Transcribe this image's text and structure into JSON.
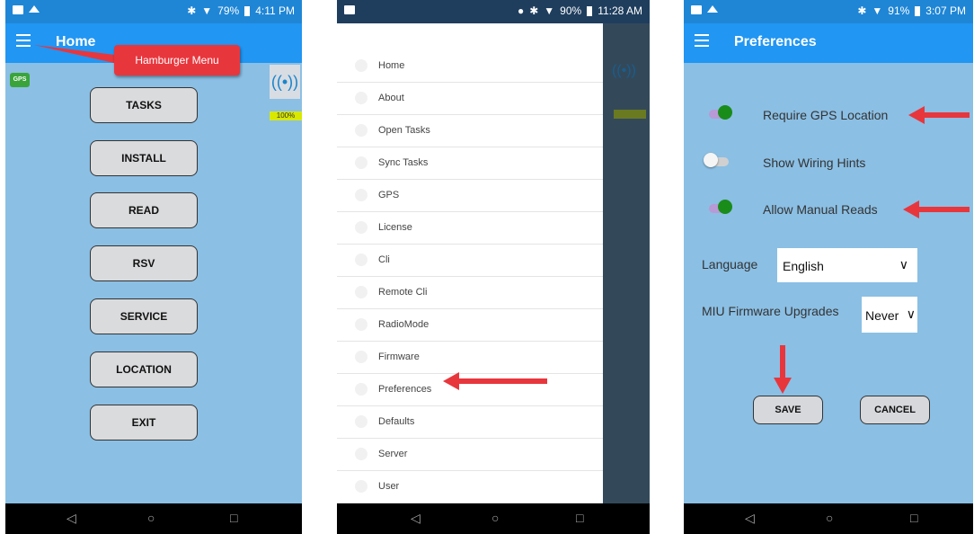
{
  "phone1": {
    "status": {
      "battery": "79%",
      "time": "4:11 PM"
    },
    "appbar_title": "Home",
    "gps_badge": "GPS",
    "battery_badge": "100%",
    "callout": "Hamburger Menu",
    "buttons": [
      "TASKS",
      "INSTALL",
      "READ",
      "RSV",
      "SERVICE",
      "LOCATION",
      "EXIT"
    ]
  },
  "phone2": {
    "status": {
      "battery": "90%",
      "time": "11:28 AM"
    },
    "drawer_items": [
      "Home",
      "About",
      "Open Tasks",
      "Sync Tasks",
      "GPS",
      "License",
      "Cli",
      "Remote Cli",
      "RadioMode",
      "Firmware",
      "Preferences",
      "Defaults",
      "Server",
      "User"
    ]
  },
  "phone3": {
    "status": {
      "battery": "91%",
      "time": "3:07 PM"
    },
    "appbar_title": "Preferences",
    "toggles": [
      {
        "label": "Require GPS Location",
        "on": true
      },
      {
        "label": "Show Wiring Hints",
        "on": false
      },
      {
        "label": "Allow Manual Reads",
        "on": true
      }
    ],
    "language_label": "Language",
    "language_value": "English",
    "firmware_label": "MIU Firmware Upgrades",
    "firmware_value": "Never",
    "save_label": "SAVE",
    "cancel_label": "CANCEL"
  },
  "colors": {
    "appbar": "#2196f3",
    "content": "#8bbfe4",
    "toggle_on": "#1a8c1a",
    "arrow": "#e8363d"
  },
  "icons": [
    "hamburger-icon",
    "gps-icon",
    "radio-signal-icon",
    "back-icon",
    "home-circle-icon",
    "recents-icon",
    "chevron-down-icon",
    "bluetooth-icon",
    "wifi-icon"
  ]
}
